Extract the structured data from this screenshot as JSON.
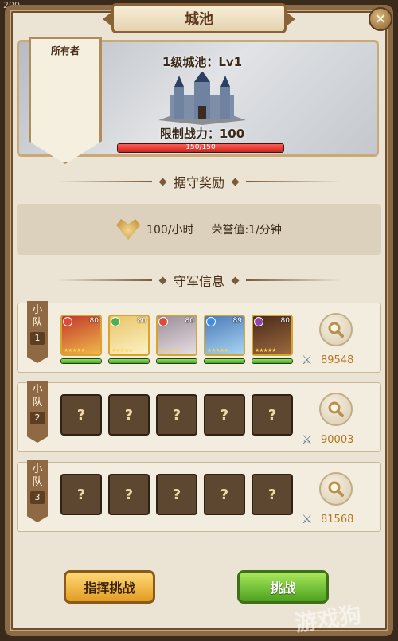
{
  "window": {
    "corner_value": "200",
    "title": "城池",
    "close_icon": "close-icon"
  },
  "castle": {
    "name": "1级城池：Lv1",
    "power_limit": "限制战力：100",
    "hp_text": "150/150",
    "hp_fraction": 1.0
  },
  "owner": {
    "label": "所有者"
  },
  "reward": {
    "header": "据守奖励",
    "honor_rate": "100/小时",
    "honor_points": "荣誉值:1/分钟"
  },
  "defense": {
    "header": "守军信息"
  },
  "squads": [
    {
      "label_chars": [
        "小",
        "队"
      ],
      "number": "1",
      "power": "89548",
      "heroes": [
        {
          "level": "80",
          "stars": "★★★★★",
          "hp": 1.0,
          "elem_color": "#e04a3a",
          "colors": [
            "#c0392b",
            "#f2b84b"
          ]
        },
        {
          "level": "80",
          "stars": "★★★★★",
          "hp": 1.0,
          "elem_color": "#4caf50",
          "colors": [
            "#e8c468",
            "#fdf2c4"
          ]
        },
        {
          "level": "80",
          "stars": "★★★★★",
          "hp": 1.0,
          "elem_color": "#e04a3a",
          "colors": [
            "#9c8f97",
            "#e6dde3"
          ]
        },
        {
          "level": "89",
          "stars": "★★★★★",
          "hp": 1.0,
          "elem_color": "#3b8ee0",
          "colors": [
            "#4d7bb8",
            "#a8d4f2"
          ]
        },
        {
          "level": "80",
          "stars": "★★★★★",
          "hp": 1.0,
          "elem_color": "#8e44ad",
          "colors": [
            "#4a2a1a",
            "#9b6a3e"
          ]
        }
      ]
    },
    {
      "label_chars": [
        "小",
        "队"
      ],
      "number": "2",
      "power": "90003",
      "locked_slots": [
        "?",
        "?",
        "?",
        "?",
        "?"
      ]
    },
    {
      "label_chars": [
        "小",
        "队"
      ],
      "number": "3",
      "power": "81568",
      "locked_slots": [
        "?",
        "?",
        "?",
        "?",
        "?"
      ]
    }
  ],
  "buttons": {
    "command_challenge": "指挥挑战",
    "challenge": "挑战"
  },
  "watermark": "游戏狗"
}
